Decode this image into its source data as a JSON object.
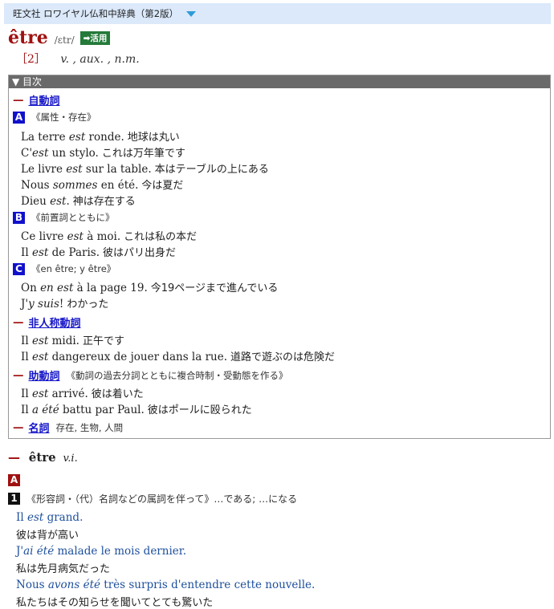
{
  "dictionary_title": "旺文社 ロワイヤル仏和中辞典（第2版）",
  "entry": {
    "headword": "être",
    "pronunciation": "/ɛtr/",
    "conjugation_button": "➡活用",
    "sense_num": "［2］",
    "parts_of_speech": "v. , aux. , n.m."
  },
  "toc": {
    "header": "▼ 目次",
    "sections": {
      "intransitive": {
        "dash": "—",
        "label": "自動詞"
      },
      "A": {
        "badge": "A",
        "gloss": "《属性・存在》"
      },
      "A_examples": [
        {
          "pre": "La terre ",
          "it": "est",
          "post": " ronde.",
          "ja": "地球は丸い"
        },
        {
          "pre": "C'",
          "it": "est",
          "post": " un stylo.",
          "ja": "これは万年筆です"
        },
        {
          "pre": "Le livre ",
          "it": "est",
          "post": " sur la table.",
          "ja": "本はテーブルの上にある"
        },
        {
          "pre": "Nous ",
          "it": "sommes",
          "post": " en été.",
          "ja": "今は夏だ"
        },
        {
          "pre": "Dieu ",
          "it": "est",
          "post": ".",
          "ja": "神は存在する"
        }
      ],
      "B": {
        "badge": "B",
        "gloss": "《前置詞とともに》"
      },
      "B_examples": [
        {
          "pre": "Ce livre ",
          "it": "est",
          "post": " à moi.",
          "ja": "これは私の本だ"
        },
        {
          "pre": "Il ",
          "it": "est",
          "post": " de Paris.",
          "ja": "彼はパリ出身だ"
        }
      ],
      "C": {
        "badge": "C",
        "gloss": "《en être; y être》"
      },
      "C_examples": [
        {
          "pre": "On ",
          "it": "en est",
          "post": " à la page 19.",
          "ja": "今19ページまで進んでいる"
        },
        {
          "pre": "J'",
          "it": "y suis",
          "post": "!",
          "ja": "わかった"
        }
      ],
      "impersonal": {
        "dash": "—",
        "label": "非人称動詞"
      },
      "impersonal_examples": [
        {
          "pre": "Il ",
          "it": "est",
          "post": " midi.",
          "ja": "正午です"
        },
        {
          "pre": "Il ",
          "it": "est",
          "post": " dangereux de jouer dans la rue.",
          "ja": "道路で遊ぶのは危険だ"
        }
      ],
      "auxiliary": {
        "dash": "—",
        "label": "助動詞",
        "gloss": "《動詞の過去分詞とともに複合時制・受動態を作る》"
      },
      "auxiliary_examples": [
        {
          "pre": "Il ",
          "it": "est",
          "post": " arrivé.",
          "ja": "彼は着いた"
        },
        {
          "pre": "Il ",
          "it": "a été",
          "post": " battu par Paul.",
          "ja": "彼はポールに殴られた"
        }
      ],
      "noun": {
        "dash": "—",
        "label": "名詞",
        "gloss": "存在, 生物, 人間"
      }
    }
  },
  "body": {
    "vi_dash": "—",
    "vi_word": "être",
    "vi_pos": "v.i.",
    "badge_A": "A",
    "badge_1": "1",
    "sense1_gloss": "《形容詞・（代）名詞などの属詞を伴って》…である; …になる",
    "examples": [
      {
        "pre": "Il ",
        "it": "est",
        "post": " grand.",
        "ja": "彼は背が高い"
      },
      {
        "pre": "J'",
        "it": "ai été",
        "post": " malade le mois dernier.",
        "ja": "私は先月病気だった"
      },
      {
        "pre": "Nous ",
        "it": "avons été",
        "post": " très surpris d'entendre cette nouvelle.",
        "ja": "私たちはその知らせを聞いてとても驚いた"
      }
    ]
  }
}
